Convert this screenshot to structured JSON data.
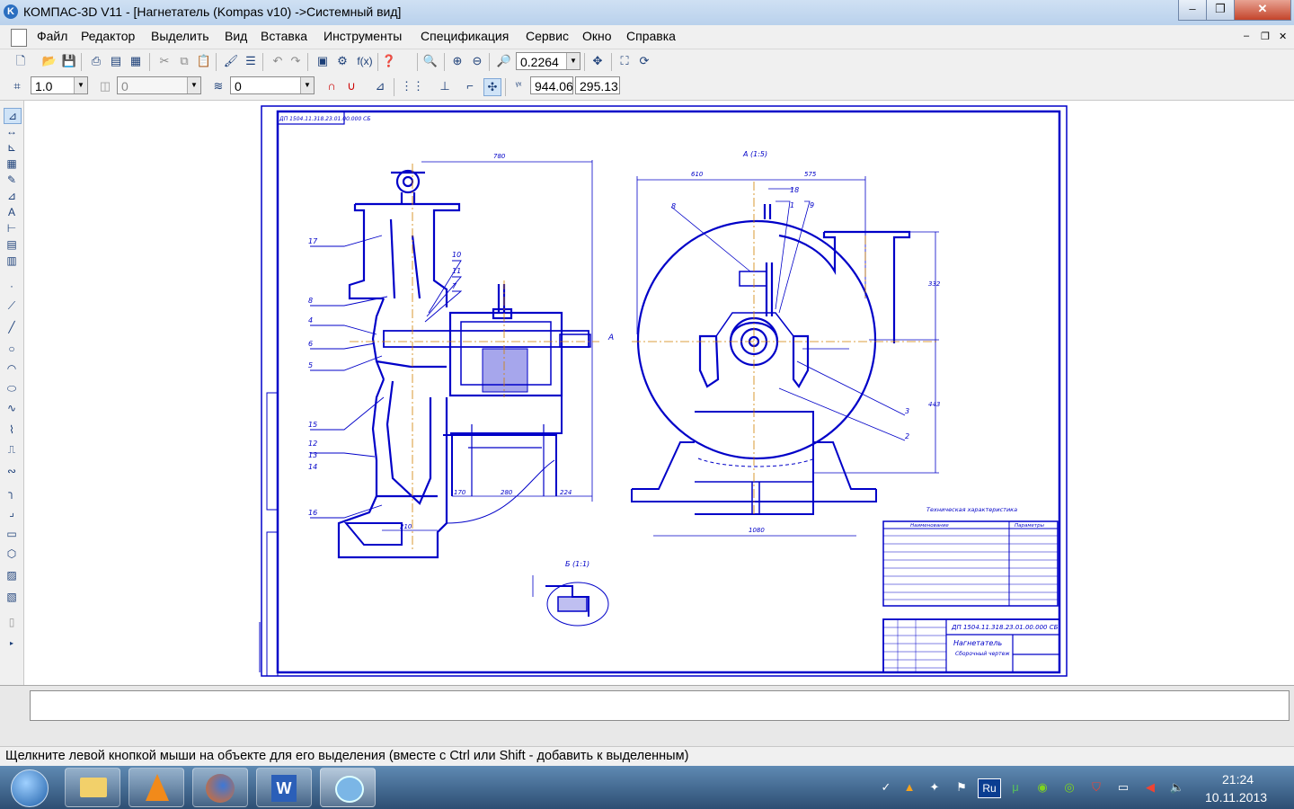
{
  "window": {
    "title": "КОМПАС-3D V11 - [Нагнетатель (Kompas v10) ->Системный вид]",
    "icon_label": "K",
    "controls": [
      "–",
      "❐",
      "✕"
    ]
  },
  "menu": {
    "items": [
      "Файл",
      "Редактор",
      "Выделить",
      "Вид",
      "Вставка",
      "Инструменты",
      "Спецификация",
      "Сервис",
      "Окно",
      "Справка"
    ],
    "mdi_controls": [
      "–",
      "❐",
      "✕"
    ]
  },
  "toolbar1": {
    "zoom_value": "0.2264",
    "fx_label": "f(x)"
  },
  "toolbar2": {
    "step_value": "1.0",
    "angle_value": "0",
    "layer_value": "0",
    "coord_x": "944.06",
    "coord_y": "295.13"
  },
  "drawing": {
    "stamp_top": "ДП 1504.11.318.23.01.00.000 СБ",
    "dim_780": "780",
    "dim_610": "610",
    "dim_575": "575",
    "dim_1080": "1080",
    "dim_170": "170",
    "dim_280": "280",
    "dim_224": "224",
    "dim_210": "210",
    "dim_332": "332",
    "dim_443": "443",
    "view_A": "А (1:5)",
    "view_B": "Б (1:1)",
    "arrow_A": "А",
    "leaders_left": [
      "17",
      "8",
      "4",
      "6",
      "5",
      "15",
      "12",
      "13",
      "14",
      "16",
      "10",
      "11",
      "7"
    ],
    "leaders_right": [
      "8",
      "18",
      "1",
      "9",
      "3",
      "2"
    ],
    "tech_title": "Техническая характеристика",
    "tech_headers": [
      "Наименование",
      "Параметры"
    ],
    "title_block_code": "ДП 1504.11.318.23.01.00.000 СБ",
    "title_block_name": "Нагнетатель",
    "title_block_sub": "Сборочный чертеж"
  },
  "status": {
    "hint": "Щелкните левой кнопкой мыши на объекте для его выделения (вместе с Ctrl или Shift - добавить к выделенным)"
  },
  "taskbar": {
    "apps": [
      "start-orb",
      "explorer",
      "vlc",
      "firefox",
      "word",
      "kompas"
    ],
    "lang": "Ru",
    "time": "21:24",
    "date": "10.11.2013"
  },
  "colors": {
    "drawing_blue": "#0000c8",
    "axis_orange": "#d08000",
    "title_bar": "#b9d1ec"
  }
}
